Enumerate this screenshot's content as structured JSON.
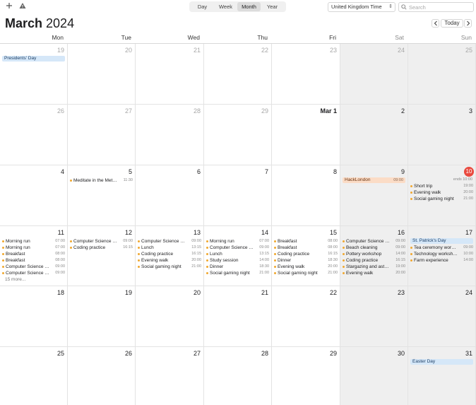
{
  "toolbar": {
    "add_icon": "plus-icon",
    "warning_icon": "warning-icon",
    "views": [
      "Day",
      "Week",
      "Month",
      "Year"
    ],
    "active_view": "Month",
    "timezone": "United Kingdom Time",
    "search_placeholder": "Search"
  },
  "header": {
    "month": "March",
    "year": "2024",
    "today_label": "Today",
    "prev_icon": "chevron-left-icon",
    "next_icon": "chevron-right-icon"
  },
  "weekdays": [
    "Mon",
    "Tue",
    "Wed",
    "Thu",
    "Fri",
    "Sat",
    "Sun"
  ],
  "colors": {
    "accent_today": "#e94a3f",
    "event_dot": "#f0a830",
    "holiday_blue": "#d5e7f8",
    "allday_orange": "#fbdcc6",
    "weekend_bg": "#efefef"
  },
  "weeks": [
    [
      {
        "label": "19",
        "other": true,
        "allday": [
          {
            "title": "Presidents' Day",
            "color": "blue"
          }
        ]
      },
      {
        "label": "20",
        "other": true
      },
      {
        "label": "21",
        "other": true
      },
      {
        "label": "22",
        "other": true
      },
      {
        "label": "23",
        "other": true
      },
      {
        "label": "24",
        "other": true
      },
      {
        "label": "25",
        "other": true
      }
    ],
    [
      {
        "label": "26",
        "other": true
      },
      {
        "label": "27",
        "other": true
      },
      {
        "label": "28",
        "other": true
      },
      {
        "label": "29",
        "other": true
      },
      {
        "label": "Mar 1",
        "bold": true
      },
      {
        "label": "2"
      },
      {
        "label": "3"
      }
    ],
    [
      {
        "label": "4"
      },
      {
        "label": "5",
        "events": [
          {
            "title": "Meditate in the Meta...",
            "time": "11:30"
          }
        ]
      },
      {
        "label": "6"
      },
      {
        "label": "7"
      },
      {
        "label": "8"
      },
      {
        "label": "9",
        "allday": [
          {
            "title": "HackLondon",
            "color": "orange",
            "time": "09:00"
          }
        ]
      },
      {
        "label": "10",
        "today": true,
        "ends": "ends 10:00",
        "events": [
          {
            "title": "Short trip",
            "time": "19:00"
          },
          {
            "title": "Evening walk",
            "time": "20:00"
          },
          {
            "title": "Social gaming night",
            "time": "21:00"
          }
        ]
      }
    ],
    [
      {
        "label": "11",
        "events": [
          {
            "title": "Morning run",
            "time": "07:00"
          },
          {
            "title": "Morning run",
            "time": "07:00"
          },
          {
            "title": "Breakfast",
            "time": "08:00"
          },
          {
            "title": "Breakfast",
            "time": "08:00"
          },
          {
            "title": "Computer Science C...",
            "time": "09:00"
          },
          {
            "title": "Computer Science L...",
            "time": "09:00"
          }
        ],
        "more": "15 more..."
      },
      {
        "label": "12",
        "events": [
          {
            "title": "Computer Science C...",
            "time": "09:00"
          },
          {
            "title": "Coding practice",
            "time": "16:15"
          }
        ]
      },
      {
        "label": "13",
        "events": [
          {
            "title": "Computer Science C...",
            "time": "09:00"
          },
          {
            "title": "Lunch",
            "time": "13:15"
          },
          {
            "title": "Coding practice",
            "time": "16:15"
          },
          {
            "title": "Evening walk",
            "time": "20:00"
          },
          {
            "title": "Social gaming night",
            "time": "21:00"
          }
        ]
      },
      {
        "label": "14",
        "events": [
          {
            "title": "Morning run",
            "time": "07:00"
          },
          {
            "title": "Computer Science C...",
            "time": "09:00"
          },
          {
            "title": "Lunch",
            "time": "13:15"
          },
          {
            "title": "Study session",
            "time": "14:00"
          },
          {
            "title": "Dinner",
            "time": "18:30"
          },
          {
            "title": "Social gaming night",
            "time": "21:00"
          }
        ]
      },
      {
        "label": "15",
        "events": [
          {
            "title": "Breakfast",
            "time": "08:00"
          },
          {
            "title": "Breakfast",
            "time": "08:00"
          },
          {
            "title": "Coding practice",
            "time": "16:15"
          },
          {
            "title": "Dinner",
            "time": "18:30"
          },
          {
            "title": "Evening walk",
            "time": "20:00"
          },
          {
            "title": "Social gaming night",
            "time": "21:00"
          }
        ]
      },
      {
        "label": "16",
        "events": [
          {
            "title": "Computer Science C...",
            "time": "09:00"
          },
          {
            "title": "Beach cleaning",
            "time": "09:00"
          },
          {
            "title": "Pottery workshop",
            "time": "14:00"
          },
          {
            "title": "Coding practice",
            "time": "16:15"
          },
          {
            "title": "Stargazing and astro...",
            "time": "19:00"
          },
          {
            "title": "Evening walk",
            "time": "20:00"
          }
        ]
      },
      {
        "label": "17",
        "allday": [
          {
            "title": "St. Patrick's Day",
            "color": "blue"
          }
        ],
        "events": [
          {
            "title": "Tea ceremony works...",
            "time": "09:00"
          },
          {
            "title": "Technology workshop",
            "time": "10:00"
          },
          {
            "title": "Farm experience",
            "time": "14:00"
          }
        ]
      }
    ],
    [
      {
        "label": "18"
      },
      {
        "label": "19"
      },
      {
        "label": "20"
      },
      {
        "label": "21"
      },
      {
        "label": "22"
      },
      {
        "label": "23"
      },
      {
        "label": "24"
      }
    ],
    [
      {
        "label": "25"
      },
      {
        "label": "26"
      },
      {
        "label": "27"
      },
      {
        "label": "28"
      },
      {
        "label": "29"
      },
      {
        "label": "30"
      },
      {
        "label": "31",
        "allday": [
          {
            "title": "Easter Day",
            "color": "blue"
          }
        ]
      }
    ]
  ]
}
